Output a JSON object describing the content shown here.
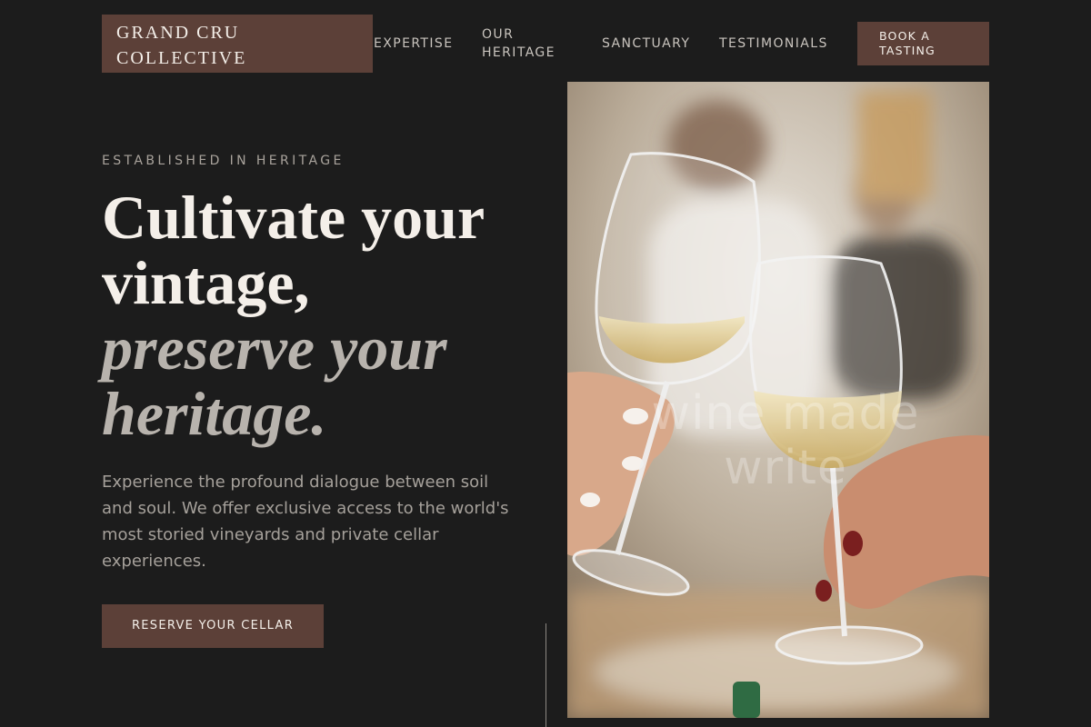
{
  "brand": {
    "name_line1": "GRAND CRU",
    "name_line2": "COLLECTIVE"
  },
  "nav": {
    "items": [
      {
        "label": "EXPERTISE"
      },
      {
        "label_line1": "OUR",
        "label_line2": "HERITAGE"
      },
      {
        "label": "SANCTUARY"
      },
      {
        "label": "TESTIMONIALS"
      }
    ],
    "cta_line1": "BOOK A",
    "cta_line2": "TASTING"
  },
  "hero": {
    "eyebrow": "ESTABLISHED IN HERITAGE",
    "headline_line1": "Cultivate your",
    "headline_line2": "vintage,",
    "headline_italic_line1": "preserve your",
    "headline_italic_line2": "heritage.",
    "lead": "Experience the profound dialogue between soil and soul. We offer exclusive access to the world's most storied vineyards and private cellar experiences.",
    "cta_label": "RESERVE YOUR CELLAR"
  },
  "photo": {
    "subject": "two hands toasting glasses of white wine",
    "watermark": "wine made write"
  },
  "colors": {
    "background": "#1c1c1c",
    "accent": "#5c4038",
    "text_primary": "#f4efe9",
    "text_muted": "#a5a09a"
  }
}
